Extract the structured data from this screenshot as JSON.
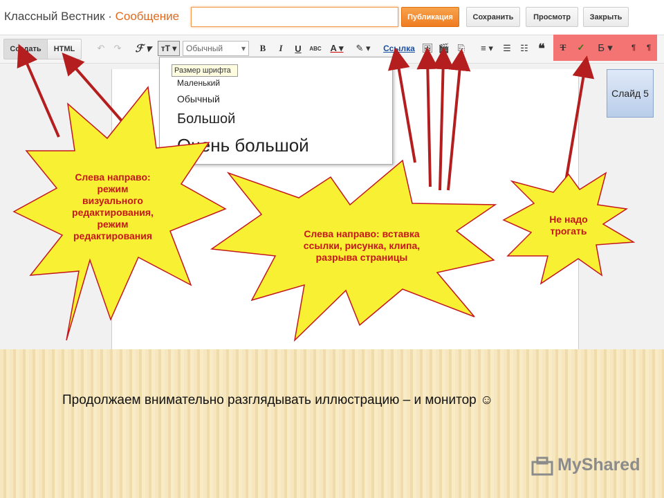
{
  "header": {
    "blog_title": "Классный Вестник",
    "separator": " · ",
    "page_title": "Сообщение",
    "post_title_value": "",
    "publish_label": "Публикация",
    "save_label": "Сохранить",
    "preview_label": "Просмотр",
    "close_label": "Закрыть"
  },
  "toolbar": {
    "compose_label": "Создать",
    "html_label": "HTML",
    "undo": "↶",
    "redo": "↷",
    "font_family": "ℱ ▾",
    "font_size": "тT ▾",
    "format_value": "Обычный",
    "format_arrow": "▾",
    "bold": "B",
    "italic": "I",
    "underline": "U",
    "strike": "ABC",
    "text_color": "A ▾",
    "highlight": "✎ ▾",
    "link_label": "Ссылка",
    "image_icon": "🖼",
    "video_icon": "🎬",
    "break_icon": "⎘",
    "align_icon": "≡ ▾",
    "ol_icon": "☰",
    "ul_icon": "☷",
    "quote_icon": "❝",
    "clear_format": "T",
    "spell_icon": "✓",
    "lang_label": "Б ▾",
    "ltr_icon": "¶",
    "rtl_icon": "¶"
  },
  "font_size_menu": {
    "tooltip": "Размер шрифта",
    "options": [
      "Маленький",
      "Обычный",
      "Большой",
      "Очень большой"
    ]
  },
  "slide_note": "Слайд 5",
  "callouts": {
    "burst1": [
      "Слева направо:",
      "режим",
      "визуального",
      "редактирования,",
      "режим",
      "редактирования"
    ],
    "burst2": [
      "Слева направо: вставка",
      "ссылки, рисунка, клипа,",
      "разрыва страницы"
    ],
    "burst3": [
      "Не надо",
      "трогать"
    ]
  },
  "caption": "Продолжаем внимательно разглядывать иллюстрацию – и монитор ☺",
  "watermark": "MyShared",
  "colors": {
    "burst_fill": "#f8f033",
    "burst_stroke": "#c4161c",
    "callout_text": "#c4161c",
    "arrow": "#b41e1e",
    "publish_button": "#ef7c22"
  }
}
